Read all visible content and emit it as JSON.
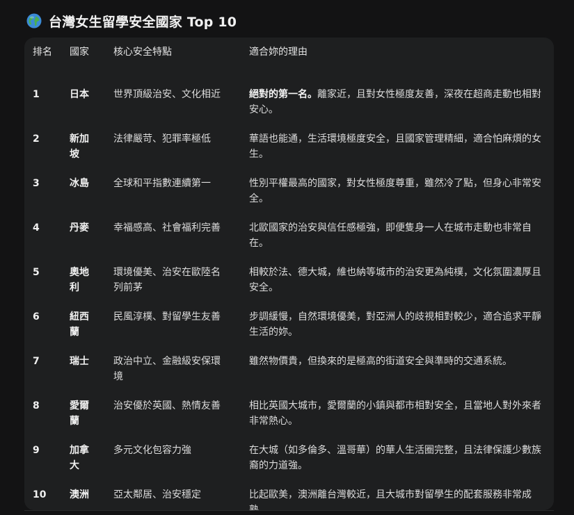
{
  "header": {
    "globe_icon": "globe-icon",
    "title": "台灣女生留學安全國家 Top 10"
  },
  "table": {
    "headers": [
      "排名",
      "國家",
      "核心安全特點",
      "適合妳的理由"
    ],
    "rows": [
      {
        "rank": "1",
        "country": "日本",
        "feature": "世界頂級治安、文化相近",
        "reason_lead": "絕對的第一名。",
        "reason": "離家近，且對女性極度友善，深夜在超商走動也相對安心。"
      },
      {
        "rank": "2",
        "country": "新加坡",
        "feature": "法律嚴苛、犯罪率極低",
        "reason_lead": "",
        "reason": "華語也能通，生活環境極度安全，且國家管理精細，適合怕麻煩的女生。"
      },
      {
        "rank": "3",
        "country": "冰島",
        "feature": "全球和平指數連續第一",
        "reason_lead": "",
        "reason": "性別平權最高的國家，對女性極度尊重，雖然冷了點，但身心非常安全。"
      },
      {
        "rank": "4",
        "country": "丹麥",
        "feature": "幸福感高、社會福利完善",
        "reason_lead": "",
        "reason": "北歐國家的治安與信任感極強，即便隻身一人在城市走動也非常自在。"
      },
      {
        "rank": "5",
        "country": "奧地利",
        "feature": "環境優美、治安在歐陸名列前茅",
        "reason_lead": "",
        "reason": "相較於法、德大城，維也納等城市的治安更為純樸，文化氛圍濃厚且安全。"
      },
      {
        "rank": "6",
        "country": "紐西蘭",
        "feature": "民風淳樸、對留學生友善",
        "reason_lead": "",
        "reason": "步調緩慢，自然環境優美，對亞洲人的歧視相對較少，適合追求平靜生活的妳。"
      },
      {
        "rank": "7",
        "country": "瑞士",
        "feature": "政治中立、金融級安保環境",
        "reason_lead": "",
        "reason": "雖然物價貴，但換來的是極高的街道安全與準時的交通系統。"
      },
      {
        "rank": "8",
        "country": "愛爾蘭",
        "feature": "治安優於英國、熱情友善",
        "reason_lead": "",
        "reason": "相比英國大城市，愛爾蘭的小鎮與都市相對安全，且當地人對外來者非常熱心。"
      },
      {
        "rank": "9",
        "country": "加拿大",
        "feature": "多元文化包容力強",
        "reason_lead": "",
        "reason": "在大城（如多倫多、溫哥華）的華人生活圈完整，且法律保護少數族裔的力道強。"
      },
      {
        "rank": "10",
        "country": "澳洲",
        "feature": "亞太鄰居、治安穩定",
        "reason_lead": "",
        "reason": "比起歐美，澳洲離台灣較近，且大城市對留學生的配套服務非常成熟。"
      }
    ]
  }
}
